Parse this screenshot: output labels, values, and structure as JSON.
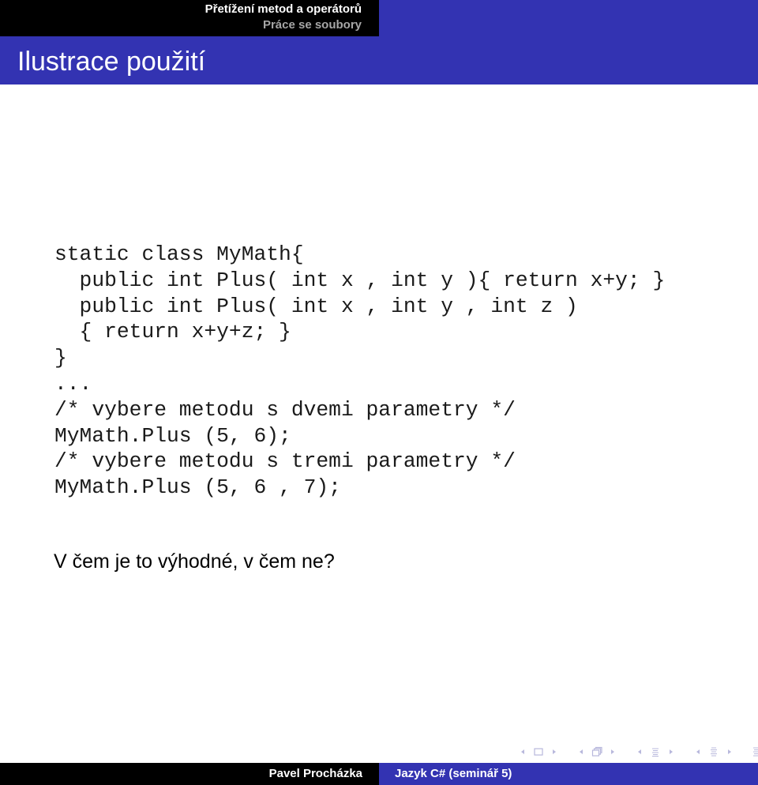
{
  "header": {
    "sections": [
      {
        "label": "Přetížení metod a operátorů",
        "current": true
      },
      {
        "label": "Práce se soubory",
        "current": false
      }
    ]
  },
  "frame": {
    "title": "Ilustrace použití"
  },
  "code": {
    "lines": [
      "static class MyMath{",
      "  public int Plus( int x , int y ){ return x+y; }",
      "  public int Plus( int x , int y , int z )",
      "  { return x+y+z; }",
      "}",
      "...",
      "/* vybere metodu s dvemi parametry */",
      "MyMath.Plus (5, 6);",
      "/* vybere metodu s tremi parametry */",
      "MyMath.Plus (5, 6 , 7);"
    ]
  },
  "question": "V čem je to výhodné, v čem ne?",
  "navigation": {
    "icons": [
      "arrow-left-icon",
      "frame-icon",
      "arrow-right-icon",
      "arrow-left-icon",
      "subsection-icon",
      "arrow-right-icon",
      "arrow-left-icon",
      "section-icon",
      "arrow-right-icon",
      "arrow-left-icon",
      "document-icon",
      "arrow-right-icon",
      "toc-icon",
      "back-icon",
      "search-icon",
      "forward-icon"
    ],
    "color": "#b8b8dc"
  },
  "footer": {
    "author": "Pavel Procházka",
    "title": "Jazyk C# (seminář 5)"
  },
  "colors": {
    "theme_blue": "#3333b2",
    "header_black": "#000000",
    "inactive_section": "#a6a6a6"
  }
}
